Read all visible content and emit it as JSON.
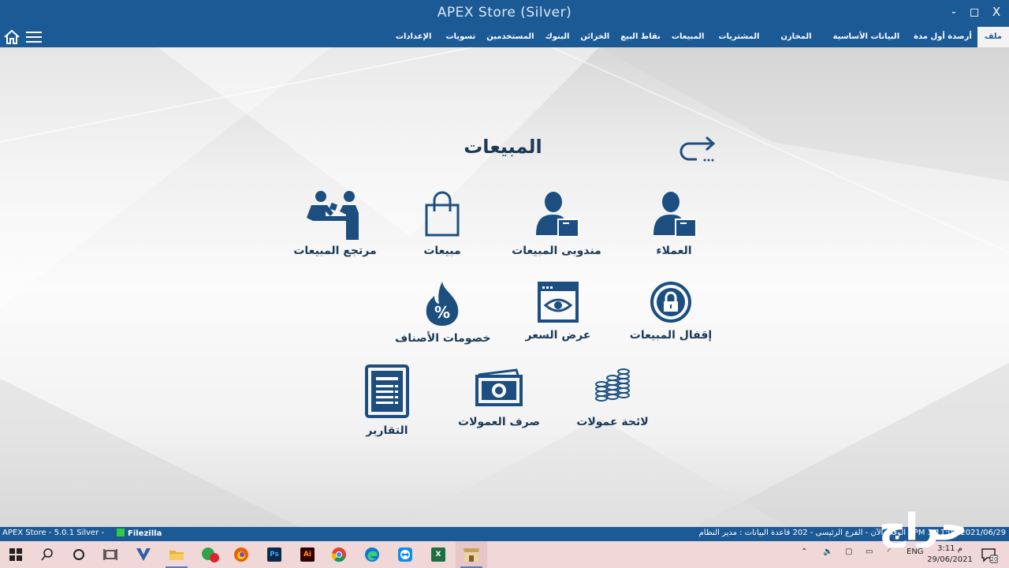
{
  "window": {
    "title": "APEX Store (Silver)",
    "minimize": "-",
    "maximize": "◻",
    "close": "X"
  },
  "menu": {
    "items": [
      "ملف",
      "أرصدة أول مدة",
      "البيانات الأساسية",
      "المخازن",
      "المشتريات",
      "المبيعات",
      "نقاط البيع",
      "الخزائن",
      "البنوك",
      "المستخدمين",
      "تسويات",
      "الإعدادات"
    ]
  },
  "page": {
    "title": "المبيعات"
  },
  "tiles": [
    {
      "label": "العملاء",
      "icon": "customer-icon"
    },
    {
      "label": "مندوبى المبيعات",
      "icon": "sales-rep-icon"
    },
    {
      "label": "مبيعات",
      "icon": "shopping-bag-icon"
    },
    {
      "label": "مرتجع المبيعات",
      "icon": "sales-return-icon"
    },
    {
      "label": "إقفال المبيعات",
      "icon": "lock-icon"
    },
    {
      "label": "عرض السعر",
      "icon": "quote-eye-icon"
    },
    {
      "label": "خصومات الأصناف",
      "icon": "discount-flame-icon"
    },
    {
      "label": "لائحة عمولات",
      "icon": "coins-stack-icon"
    },
    {
      "label": "صرف العمولات",
      "icon": "banknote-icon"
    },
    {
      "label": "التقارير",
      "icon": "report-document-icon"
    }
  ],
  "status": {
    "app_version": "APEX Store - 5.0.1  Silver  -",
    "filezilla": "Filezilla",
    "right_text": "PM 3:11:04 2021/06/29 : الوقت الآن  -  الفرع الرئيسى  -  202   قاعدة البيانات : مدير النظام"
  },
  "taskbar": {
    "badge": "2",
    "lang": "ENG",
    "time": "م 3:11",
    "date": "29/06/2021",
    "notifications": "20",
    "watermark": "حراج"
  },
  "colors": {
    "primary": "#1c5a96",
    "icon": "#1c4f80",
    "text": "#1b3a57"
  }
}
